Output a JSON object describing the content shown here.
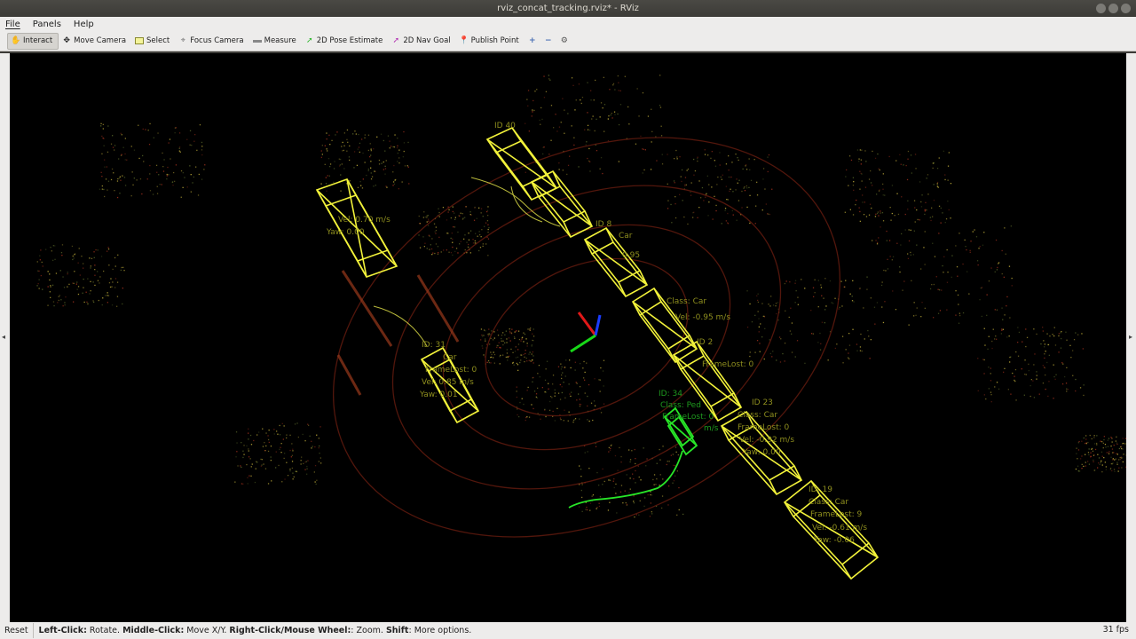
{
  "window": {
    "title": "rviz_concat_tracking.rviz* - RViz"
  },
  "menu": {
    "file": "File",
    "panels": "Panels",
    "help": "Help"
  },
  "toolbar": {
    "interact": "Interact",
    "move_camera": "Move Camera",
    "select": "Select",
    "focus_camera": "Focus Camera",
    "measure": "Measure",
    "pose_estimate": "2D Pose Estimate",
    "nav_goal": "2D Nav Goal",
    "publish_point": "Publish Point"
  },
  "status": {
    "reset": "Reset",
    "hint_parts": [
      {
        "b": "Left-Click:",
        "t": " Rotate. "
      },
      {
        "b": "Middle-Click:",
        "t": " Move X/Y. "
      },
      {
        "b": "Right-Click/Mouse Wheel:",
        "t": ": Zoom. "
      },
      {
        "b": "Shift",
        "t": ": More options."
      }
    ],
    "fps": "31 fps"
  },
  "colors": {
    "box_yellow": "#f2f23a",
    "track_green": "#28e628",
    "points_red": "#a8321e",
    "points_yellow": "#c8b43c"
  },
  "labels": {
    "top": {
      "id": "ID 40"
    },
    "r1": {
      "id": "ID 8",
      "cls": "Car",
      "vel": "0.95",
      "yaw": ""
    },
    "mid": {
      "id": "ID 2",
      "flost": "FrameLost: 0",
      "vel": "Vel: -0.95 m/s",
      "cls": "Class: Car"
    },
    "r2": {
      "id": "ID 23",
      "cls": "Class: Car",
      "flost": "FrameLost: 0",
      "vel": "Vel: -0.92 m/s",
      "yaw": "Yaw: 0.00"
    },
    "bottom": {
      "id": "ID: 19",
      "cls": "Class: Car",
      "flost": "FrameLost: 9",
      "vel": "Vel: -0.61 m/s",
      "yaw": "Yaw: -0.06"
    },
    "left": {
      "id": "ID: 31",
      "cls": "Car",
      "flost": "FrameLost: 0",
      "vel": "Vel: 0.85 m/s",
      "yaw": "Yaw: 0.01"
    },
    "green": {
      "id": "ID: 34",
      "cls": "Class: Ped",
      "flost": "FrameLost: 0",
      "vel": "m/s"
    },
    "topleft": {
      "vel": "Vel: 0.70 m/s",
      "yaw": "Yaw: 0.00"
    }
  }
}
